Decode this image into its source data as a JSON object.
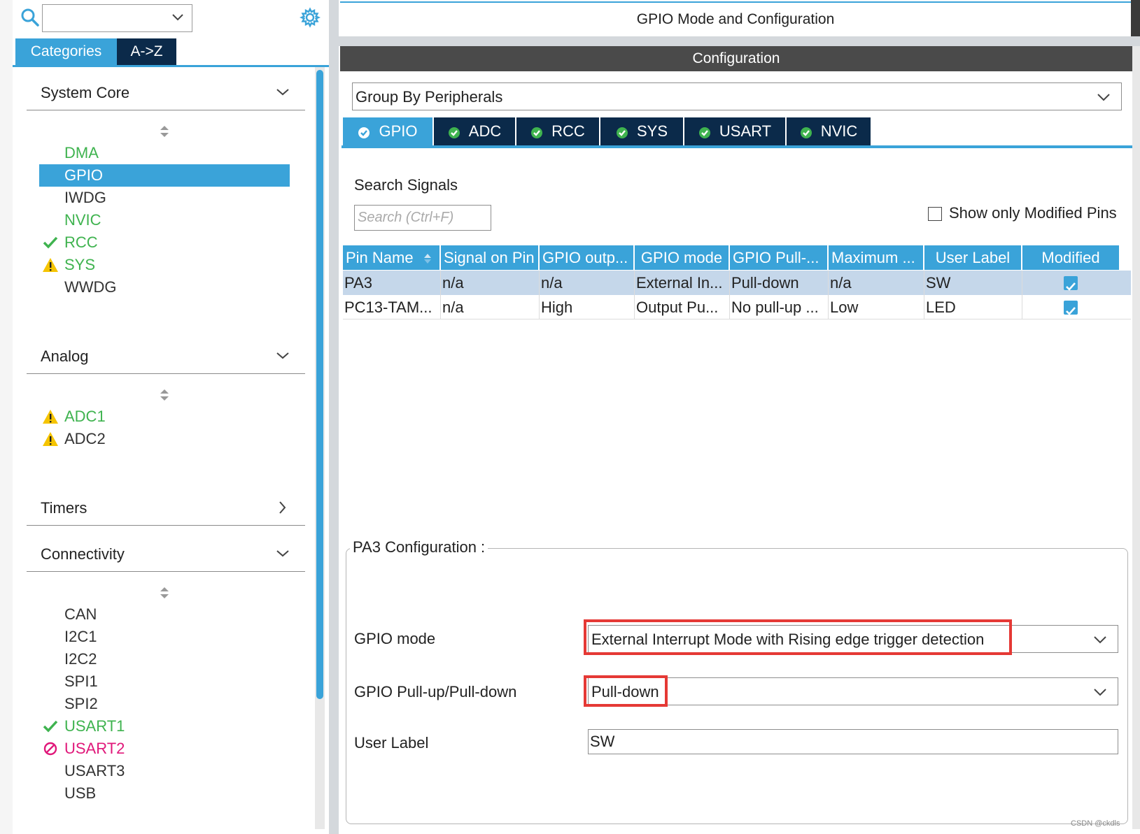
{
  "left": {
    "search_value": "",
    "tabs": {
      "categories": "Categories",
      "az": "A->Z"
    },
    "categories": [
      {
        "title": "System Core",
        "expanded": true,
        "items": [
          {
            "name": "DMA",
            "status": "none",
            "color": "green"
          },
          {
            "name": "GPIO",
            "status": "none",
            "color": "white",
            "selected": true
          },
          {
            "name": "IWDG",
            "status": "none",
            "color": "dark"
          },
          {
            "name": "NVIC",
            "status": "none",
            "color": "green"
          },
          {
            "name": "RCC",
            "status": "check",
            "color": "green"
          },
          {
            "name": "SYS",
            "status": "warning",
            "color": "green"
          },
          {
            "name": "WWDG",
            "status": "none",
            "color": "dark"
          }
        ]
      },
      {
        "title": "Analog",
        "expanded": true,
        "items": [
          {
            "name": "ADC1",
            "status": "warning",
            "color": "green"
          },
          {
            "name": "ADC2",
            "status": "warning",
            "color": "dark"
          }
        ]
      },
      {
        "title": "Timers",
        "expanded": false,
        "items": []
      },
      {
        "title": "Connectivity",
        "expanded": true,
        "items": [
          {
            "name": "CAN",
            "status": "none",
            "color": "dark"
          },
          {
            "name": "I2C1",
            "status": "none",
            "color": "dark"
          },
          {
            "name": "I2C2",
            "status": "none",
            "color": "dark"
          },
          {
            "name": "SPI1",
            "status": "none",
            "color": "dark"
          },
          {
            "name": "SPI2",
            "status": "none",
            "color": "dark"
          },
          {
            "name": "USART1",
            "status": "check",
            "color": "green"
          },
          {
            "name": "USART2",
            "status": "blocked",
            "color": "magenta"
          },
          {
            "name": "USART3",
            "status": "none",
            "color": "dark"
          },
          {
            "name": "USB",
            "status": "none",
            "color": "dark"
          }
        ]
      }
    ]
  },
  "right": {
    "title": "GPIO Mode and Configuration",
    "config_header": "Configuration",
    "group_by": "Group By Peripherals",
    "peripheral_tabs": [
      "GPIO",
      "ADC",
      "RCC",
      "SYS",
      "USART",
      "NVIC"
    ],
    "active_tab": "GPIO",
    "search_signals_label": "Search Signals",
    "search_placeholder": "Search (Ctrl+F)",
    "show_modified_label": "Show only Modified Pins",
    "table": {
      "headers": [
        "Pin Name",
        "Signal on Pin",
        "GPIO outp...",
        "GPIO mode",
        "GPIO Pull-...",
        "Maximum ...",
        "User Label",
        "Modified"
      ],
      "rows": [
        {
          "cells": [
            "PA3",
            "n/a",
            "n/a",
            "External In...",
            "Pull-down",
            "n/a",
            "SW"
          ],
          "modified": true,
          "selected": true
        },
        {
          "cells": [
            "PC13-TAM...",
            "n/a",
            "High",
            "Output Pu...",
            "No pull-up ...",
            "Low",
            "LED"
          ],
          "modified": true,
          "selected": false
        }
      ]
    },
    "pin_config": {
      "legend": "PA3 Configuration :",
      "gpio_mode_label": "GPIO mode",
      "gpio_mode_value": "External Interrupt Mode with Rising edge trigger detection",
      "pull_label": "GPIO Pull-up/Pull-down",
      "pull_value": "Pull-down",
      "user_label_label": "User Label",
      "user_label_value": "SW"
    }
  },
  "watermark": "CSDN @ckdls",
  "colors": {
    "accent": "#3aa3d9",
    "navy": "#0b2a4a",
    "green": "#3fb34f",
    "warning": "#f5c400",
    "magenta": "#e0187a",
    "highlight": "#e53935"
  }
}
